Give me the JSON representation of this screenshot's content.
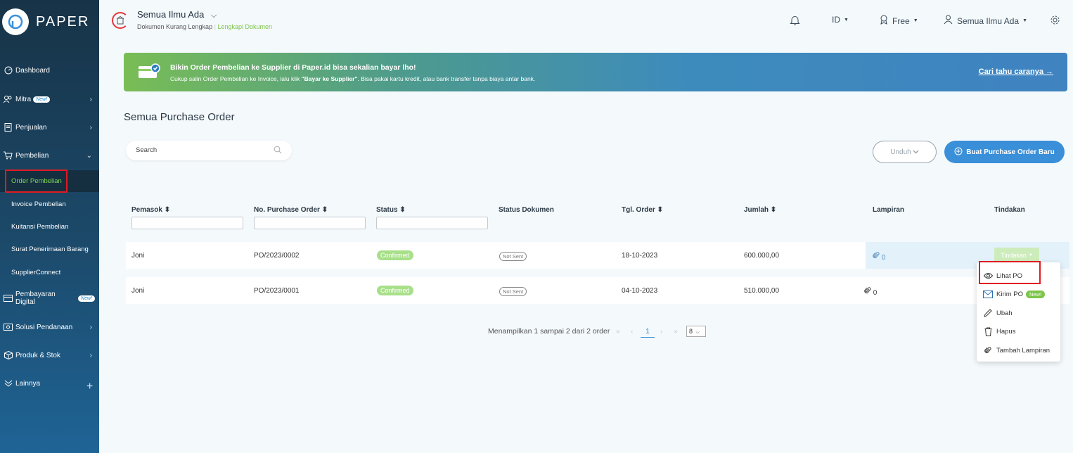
{
  "brand": {
    "name": "PAPER"
  },
  "sidebar": {
    "items": [
      {
        "label": "Dashboard"
      },
      {
        "label": "Mitra",
        "badge": "New!"
      },
      {
        "label": "Penjualan"
      },
      {
        "label": "Pembelian"
      },
      {
        "label": "Pembayaran Digital",
        "badge": "New!"
      },
      {
        "label": "Solusi Pendanaan"
      },
      {
        "label": "Produk & Stok"
      },
      {
        "label": "Lainnya"
      }
    ],
    "sub_items": [
      {
        "label": "Order Pembelian",
        "active": true
      },
      {
        "label": "Invoice Pembelian"
      },
      {
        "label": "Kuitansi Pembelian"
      },
      {
        "label": "Surat Penerimaan Barang"
      },
      {
        "label": "SupplierConnect"
      }
    ]
  },
  "header": {
    "company": "Semua Ilmu Ada",
    "doc_status": "Dokumen Kurang Lengkap",
    "doc_link": "Lengkapi Dokumen",
    "lang": "ID",
    "plan": "Free",
    "user": "Semua Ilmu Ada"
  },
  "banner": {
    "title": "Bikin Order Pembelian ke Supplier di Paper.id bisa sekalian bayar lho!",
    "sub_pre": "Cukup salin Order Pembelian ke Invoice, lalu klik ",
    "sub_bold": "\"Bayar ke Supplier\"",
    "sub_post": ". Bisa pakai kartu kredit, atau bank transfer tanpa biaya antar bank.",
    "link": "Cari tahu caranya →"
  },
  "page": {
    "title": "Semua Purchase Order",
    "search_placeholder": "Search",
    "unduh_label": "Unduh",
    "new_button": "Buat Purchase Order Baru"
  },
  "table": {
    "headers": [
      "Pemasok",
      "No. Purchase Order",
      "Status",
      "Status Dokumen",
      "Tgl. Order",
      "Jumlah",
      "Lampiran",
      "Tindakan"
    ],
    "rows": [
      {
        "pemasok": "Joni",
        "no": "PO/2023/0002",
        "status": "Confirmed",
        "status_dok": "Not Sent",
        "tgl": "18-10-2023",
        "jumlah": "600.000,00",
        "lampiran": "0",
        "tindakan": "Tindakan"
      },
      {
        "pemasok": "Joni",
        "no": "PO/2023/0001",
        "status": "Confirmed",
        "status_dok": "Not Sent",
        "tgl": "04-10-2023",
        "jumlah": "510.000,00",
        "lampiran": "0"
      }
    ]
  },
  "pagination": {
    "summary": "Menampilkan 1 sampai 2 dari 2 order",
    "current": "1",
    "per_page": "8"
  },
  "menu": {
    "items": [
      {
        "label": "Lihat PO"
      },
      {
        "label": "Kirim PO",
        "badge": "New!"
      },
      {
        "label": "Ubah"
      },
      {
        "label": "Hapus"
      },
      {
        "label": "Tambah Lampiran"
      }
    ]
  },
  "colors": {
    "accent": "#3a8fd9",
    "green": "#7cc548",
    "highlight": "#e01b22"
  }
}
